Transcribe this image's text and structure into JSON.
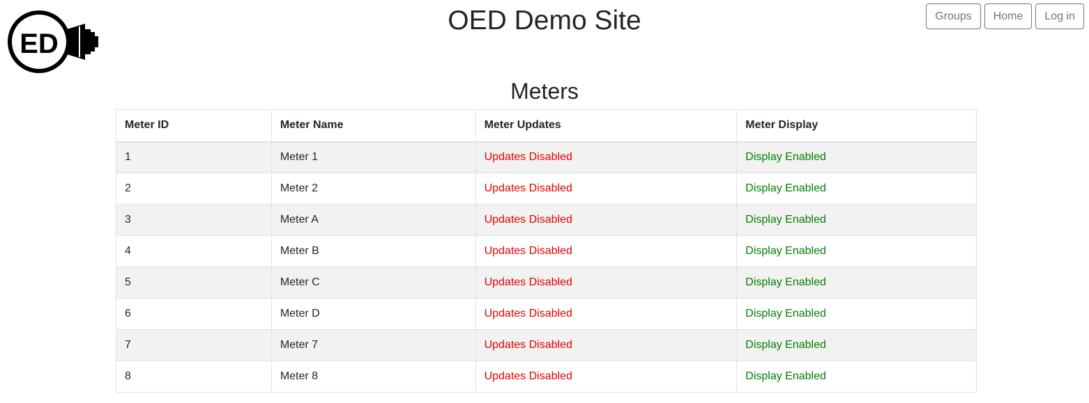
{
  "header": {
    "title": "OED Demo Site",
    "logo_text": "ED"
  },
  "nav": {
    "groups_label": "Groups",
    "home_label": "Home",
    "login_label": "Log in"
  },
  "main": {
    "title": "Meters",
    "columns": [
      "Meter ID",
      "Meter Name",
      "Meter Updates",
      "Meter Display"
    ],
    "rows": [
      {
        "id": "1",
        "name": "Meter 1",
        "updates": "Updates Disabled",
        "display": "Display Enabled"
      },
      {
        "id": "2",
        "name": "Meter 2",
        "updates": "Updates Disabled",
        "display": "Display Enabled"
      },
      {
        "id": "3",
        "name": "Meter A",
        "updates": "Updates Disabled",
        "display": "Display Enabled"
      },
      {
        "id": "4",
        "name": "Meter B",
        "updates": "Updates Disabled",
        "display": "Display Enabled"
      },
      {
        "id": "5",
        "name": "Meter C",
        "updates": "Updates Disabled",
        "display": "Display Enabled"
      },
      {
        "id": "6",
        "name": "Meter D",
        "updates": "Updates Disabled",
        "display": "Display Enabled"
      },
      {
        "id": "7",
        "name": "Meter 7",
        "updates": "Updates Disabled",
        "display": "Display Enabled"
      },
      {
        "id": "8",
        "name": "Meter 8",
        "updates": "Updates Disabled",
        "display": "Display Enabled"
      }
    ]
  },
  "colors": {
    "disabled": "#e60000",
    "enabled": "#008000",
    "stripe": "#f2f2f2",
    "button_border": "#6c757d"
  }
}
